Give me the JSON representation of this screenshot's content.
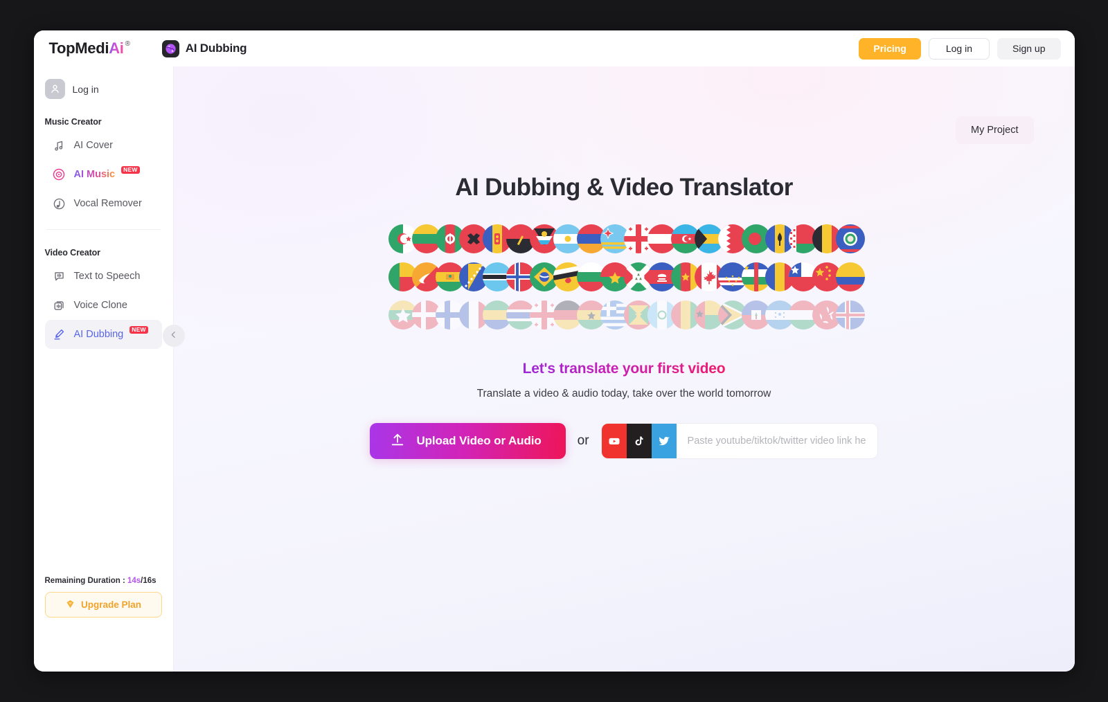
{
  "topbar": {
    "brand_prefix": "TopMedi",
    "brand_accent": "Ai",
    "brand_registered": "®",
    "app_title": "AI Dubbing",
    "app_icon": "globe-icon",
    "pricing_label": "Pricing",
    "login_label": "Log in",
    "signup_label": "Sign up",
    "colors": {
      "pricing_bg": "#ffb328",
      "signup_bg": "#f2f2f5"
    }
  },
  "sidebar": {
    "login_label": "Log in",
    "avatar_icon": "user-icon",
    "collapse_icon": "chevron-left-icon",
    "sections": [
      {
        "title": "Music Creator",
        "items": [
          {
            "label": "AI Cover",
            "icon": "music-note-icon",
            "badge": "",
            "state": "default"
          },
          {
            "label": "AI Music",
            "icon": "vinyl-record-icon",
            "badge": "NEW",
            "state": "gradient"
          },
          {
            "label": "Vocal Remover",
            "icon": "vocal-remover-icon",
            "badge": "",
            "state": "default"
          }
        ]
      },
      {
        "title": "Video Creator",
        "items": [
          {
            "label": "Text to Speech",
            "icon": "speech-bubble-icon",
            "badge": "",
            "state": "default"
          },
          {
            "label": "Voice Clone",
            "icon": "voice-clone-icon",
            "badge": "",
            "state": "default"
          },
          {
            "label": "AI Dubbing",
            "icon": "microphone-icon",
            "badge": "NEW",
            "state": "active"
          }
        ]
      }
    ],
    "footer": {
      "remaining_label": "Remaining Duration :",
      "remaining_used": "14s",
      "remaining_total": "/16s",
      "upgrade_label": "Upgrade Plan",
      "upgrade_icon": "diamond-icon",
      "used_color": "#b455ea",
      "upgrade_color": "#f0a32a"
    }
  },
  "main": {
    "my_project_label": "My Project",
    "hero_title": "AI Dubbing & Video Translator",
    "cta_title": "Let's translate your first video",
    "cta_subtitle": "Translate a video & audio today, take over the world tomorrow",
    "upload_label": "Upload Video or Audio",
    "upload_icon": "upload-icon",
    "or_label": "or",
    "link_placeholder": "Paste youtube/tiktok/twitter video link here.",
    "link_value": "",
    "socials": [
      {
        "name": "youtube-icon",
        "color": "#f0332f"
      },
      {
        "name": "tiktok-icon",
        "color": "#231f20"
      },
      {
        "name": "twitter-icon",
        "color": "#3aa2e0"
      }
    ],
    "cta_gradient": [
      "#9b2ad8",
      "#ef1b6c"
    ],
    "upload_gradient": [
      "#a936e8",
      "#ee1559"
    ],
    "flag_rows": [
      {
        "opacity": 1,
        "flags": [
          "Algeria",
          "Lithuania",
          "Afghanistan",
          "Albania",
          "Andorra",
          "Angola",
          "Antigua and Barbuda",
          "Argentina",
          "Armenia",
          "Aruba",
          "Georgia",
          "Austria",
          "Azerbaijan",
          "Bahamas",
          "Bahrain",
          "Bangladesh",
          "Barbados",
          "Belarus",
          "Belgium",
          "Belize"
        ]
      },
      {
        "opacity": 1,
        "flags": [
          "Benin",
          "Bhutan",
          "Bolivia",
          "Bosnia",
          "Botswana",
          "Norway",
          "Brazil",
          "Brunei",
          "Bulgaria",
          "Burkina Faso",
          "Burundi",
          "Cambodia",
          "Cameroon",
          "Canada",
          "Cape Verde",
          "Central African Republic",
          "Chad",
          "Chile",
          "China",
          "Colombia"
        ]
      },
      {
        "opacity": 0.34,
        "flags": [
          "Myanmar",
          "Denmark",
          "Finland",
          "France",
          "Gabon",
          "Gambia",
          "Georgia",
          "Germany",
          "Ghana",
          "Greece",
          "Grenada",
          "Guatemala",
          "Guinea",
          "Guinea-Bissau",
          "Guyana",
          "Haiti",
          "Honduras",
          "Hungary",
          "Hong Kong",
          "Iceland"
        ]
      }
    ]
  }
}
